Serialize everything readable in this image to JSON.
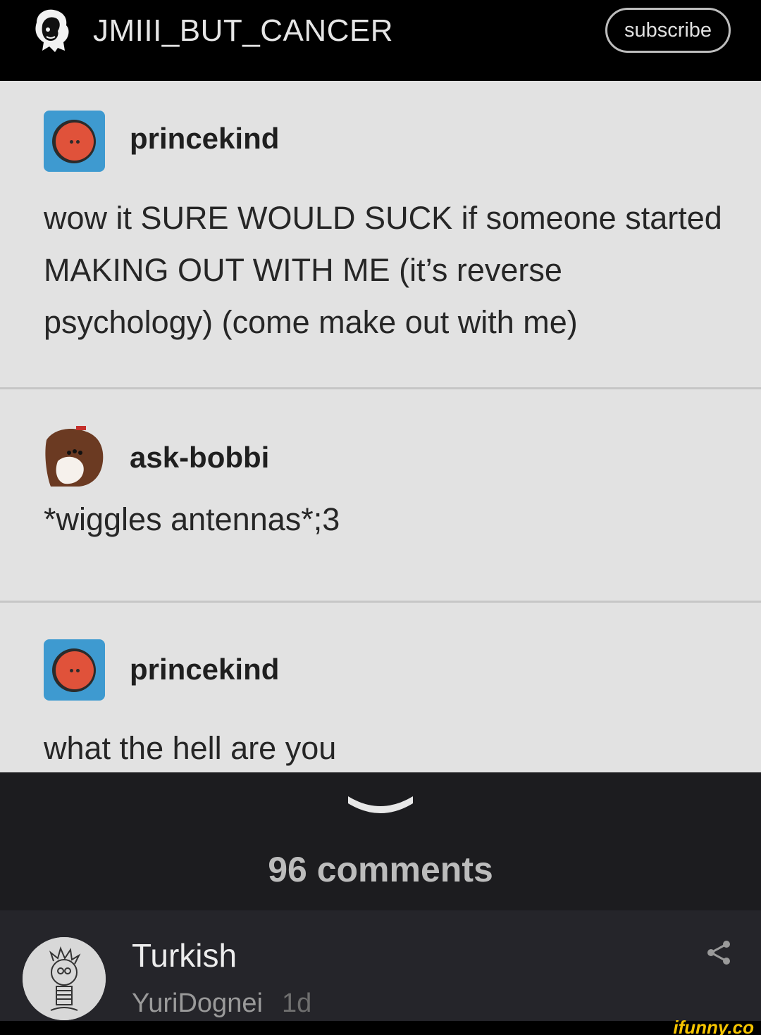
{
  "header": {
    "channel_name": "JMIII_BUT_CANCER",
    "subscribe_label": "subscribe"
  },
  "post": {
    "entries": [
      {
        "username": "princekind",
        "text": "wow it SURE WOULD SUCK if someone started MAKING OUT WITH ME (it’s reverse psychology) (come make out with me)"
      },
      {
        "username": "ask-bobbi",
        "text": "*wiggles antennas*;3"
      },
      {
        "username": "princekind",
        "text": "what the hell are you"
      }
    ]
  },
  "comments": {
    "count_label": "96 comments",
    "items": [
      {
        "text": "Turkish",
        "user": "YuriDognei",
        "time": "1d"
      }
    ]
  },
  "footer": {
    "brand": "ifunny.co"
  },
  "colors": {
    "header_bg": "#000000",
    "post_bg": "#e2e2e2",
    "comments_bg": "#1c1c1f",
    "brand_yellow": "#f5c400"
  }
}
